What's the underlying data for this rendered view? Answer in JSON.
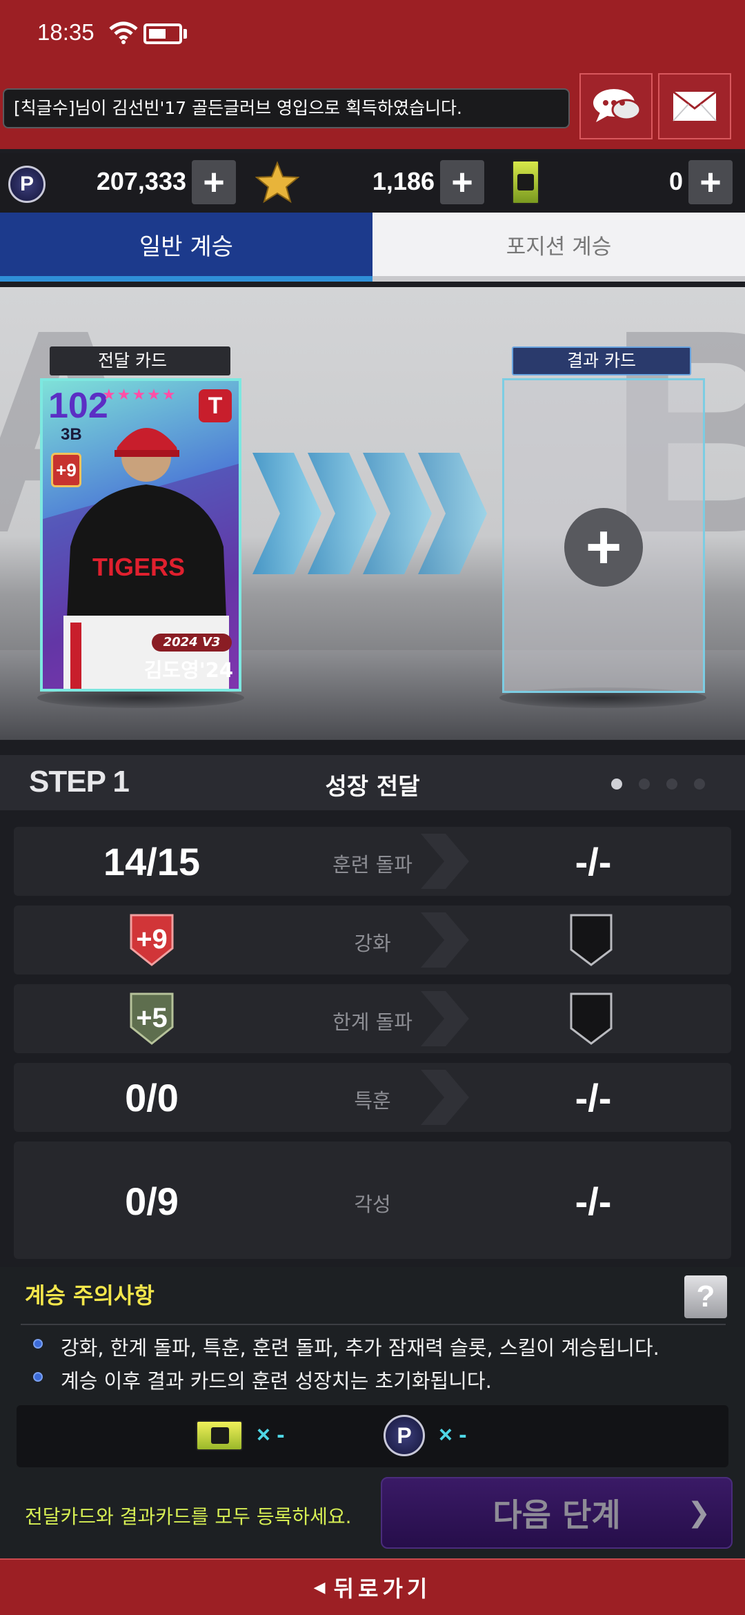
{
  "status_bar": {
    "time": "18:35"
  },
  "ticker": {
    "message": "[칙글수]님이 김선빈'17 골든글러브 영입으로 획득하였습니다."
  },
  "currency": {
    "points": "207,333",
    "stars": "1,186",
    "tickets": "0",
    "plus": "+"
  },
  "tabs": [
    {
      "label": "일반 계승",
      "active": true
    },
    {
      "label": "포지션 계승",
      "active": false
    }
  ],
  "stage": {
    "transfer_label": "전달 카드",
    "result_label": "결과 카드",
    "plus": "+",
    "card": {
      "ovr": "102",
      "position": "3B",
      "stars": "★★★★★",
      "upgrade": "+9",
      "year_badge": "2024 V3",
      "name": "김도영'24",
      "jersey_text": "TIGERS",
      "team_logo": "T"
    }
  },
  "step": {
    "label": "STEP 1",
    "title": "성장 전달",
    "total_pages": 4,
    "current_page": 1
  },
  "rows": [
    {
      "left": "14/15",
      "label": "훈련 돌파",
      "right": "-/-"
    },
    {
      "left_badge": "+9",
      "label": "강화",
      "right_icon": "empty-shield-icon"
    },
    {
      "left_badge": "+5",
      "label": "한계 돌파",
      "right_icon": "empty-shield-icon"
    },
    {
      "left": "0/0",
      "label": "특훈",
      "right": "-/-"
    },
    {
      "left": "0/9",
      "label": "각성",
      "right": "-/-"
    }
  ],
  "notice": {
    "title": "계승 주의사항",
    "help": "?",
    "lines": [
      "강화, 한계 돌파, 특훈, 훈련 돌파, 추가 잠재력 슬롯, 스킬이 계승됩니다.",
      "계승 이후 결과 카드의 훈련 성장치는 초기화됩니다."
    ]
  },
  "cost": {
    "ticket": "× -",
    "points": "× -"
  },
  "hint": "전달카드와 결과카드를 모두 등록하세요.",
  "next_button": {
    "label": "다음 단계",
    "chevron": "❯"
  },
  "back_button": {
    "arrow": "◀",
    "label": "뒤로가기"
  },
  "colors": {
    "brand_red": "#9c1f24",
    "tab_active": "#1c3a8c",
    "accent_cyan": "#4fd7e6",
    "notice_yellow": "#f3e64b"
  }
}
